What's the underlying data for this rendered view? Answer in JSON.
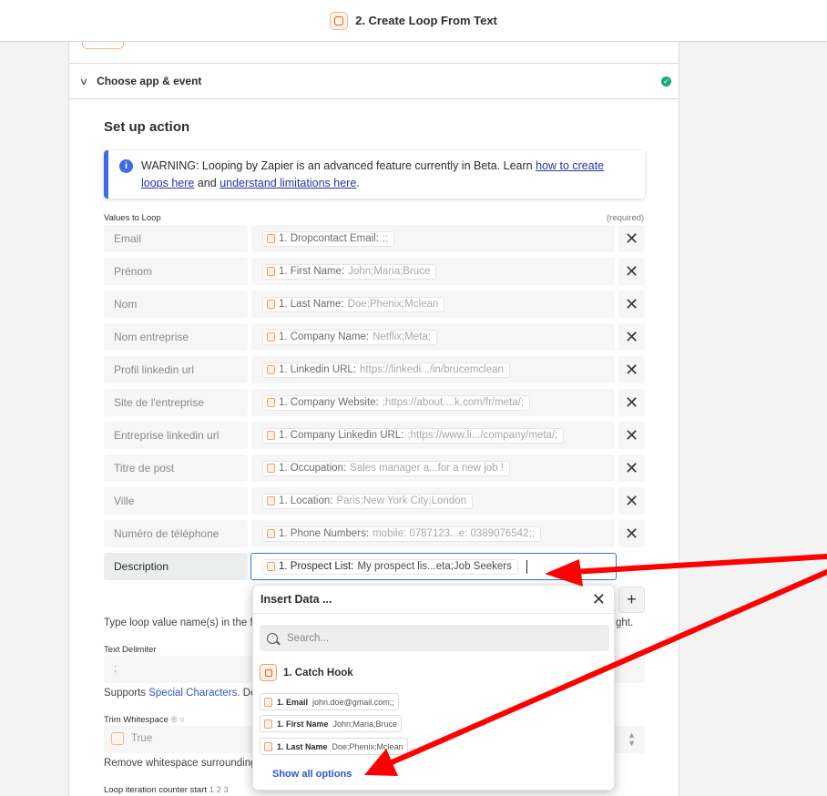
{
  "header": {
    "title": "2. Create Loop From Text"
  },
  "section": {
    "title": "Choose app & event"
  },
  "setup": {
    "title": "Set up action"
  },
  "warning": {
    "text_before": "WARNING: Looping by Zapier is an advanced feature currently in Beta. Learn ",
    "link1": "how to create loops here",
    "text_mid": " and ",
    "link2": "understand limitations here",
    "text_after": "."
  },
  "values": {
    "label": "Values to Loop",
    "required": "(required)",
    "rows": [
      {
        "key": "Email",
        "pill_key": "1. Dropcontact Email:",
        "pill_value": ";;"
      },
      {
        "key": "Prénom",
        "pill_key": "1. First Name:",
        "pill_value": "John;Maria;Bruce"
      },
      {
        "key": "Nom",
        "pill_key": "1. Last Name:",
        "pill_value": "Doe;Phenix;Mclean"
      },
      {
        "key": "Nom entreprise",
        "pill_key": "1. Company Name:",
        "pill_value": "Netflix;Meta;"
      },
      {
        "key": "Profil linkedin url",
        "pill_key": "1. Linkedin URL:",
        "pill_value": "https://linkedi.../in/brucemclean"
      },
      {
        "key": "Site de l'entreprise",
        "pill_key": "1. Company Website:",
        "pill_value": ";https://about....k.com/fr/meta/;"
      },
      {
        "key": "Entreprise linkedin url",
        "pill_key": "1. Company Linkedin URL:",
        "pill_value": ";https://www.li.../company/meta/;"
      },
      {
        "key": "Titre de post",
        "pill_key": "1. Occupation:",
        "pill_value": "Sales manager a...for a new job !"
      },
      {
        "key": "Ville",
        "pill_key": "1. Location:",
        "pill_value": "Paris;New York City;London"
      },
      {
        "key": "Numéro de téléphone",
        "pill_key": "1. Phone Numbers:",
        "pill_value": "mobile: 0787123...e: 0389076542;;"
      }
    ],
    "active_row": {
      "key": "Description",
      "pill_key": "1. Prospect List:",
      "pill_value": "My prospect lis...eta;Job Seekers"
    }
  },
  "below": {
    "hint_text": "Type loop value name(s) in the fie",
    "hint_tail": "ght.",
    "delimiter_label": "Text Delimiter",
    "delimiter_value": ";",
    "supports_text": "Supports ",
    "special_chars": "Special Characters",
    "defa_text": ". Defa",
    "trim_label": "Trim Whitespace",
    "trim_value": "True",
    "remove_text": "Remove whitespace surrounding",
    "counter_label": "Loop iteration counter start",
    "counter_nums": "1 2 3"
  },
  "insert_data": {
    "title": "Insert Data ...",
    "search_placeholder": "Search...",
    "step_label": "1. Catch Hook",
    "options": [
      {
        "key": "1. Email",
        "value": "john.doe@gmail.com;;"
      },
      {
        "key": "1. First Name",
        "value": "John;Maria;Bruce"
      },
      {
        "key": "1. Last Name",
        "value": "Doe;Phenix;Mclean"
      }
    ],
    "show_all": "Show all options"
  },
  "colors": {
    "accent": "#3d6ce4",
    "brand": "#ff4f00",
    "arrow": "#ff0000",
    "success": "#1fa873"
  }
}
